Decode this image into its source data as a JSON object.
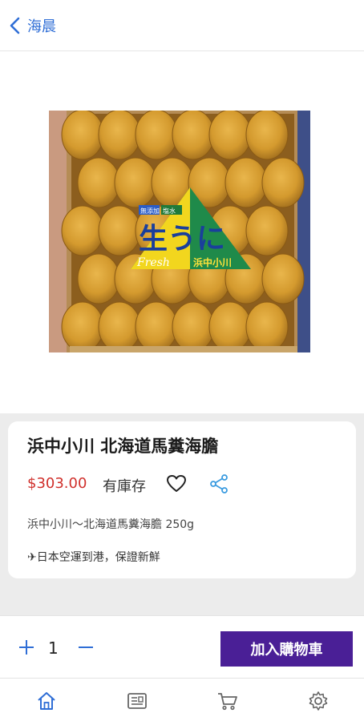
{
  "header": {
    "back_label": "海晨"
  },
  "product": {
    "name": "浜中小川 北海道馬糞海膽",
    "price": "$303.00",
    "stock_status": "有庫存",
    "description": "浜中小川～北海道馬糞海膽 250g",
    "note": "✈日本空運到港，保證新鮮",
    "image": {
      "label_main": "生うに",
      "label_fresh": "Fresh",
      "label_brand": "浜中小川",
      "label_tag1": "無添加",
      "label_tag2": "塩水"
    }
  },
  "cart": {
    "quantity": "1",
    "add_label": "加入購物車"
  },
  "colors": {
    "accent": "#2f6ed6",
    "price": "#d0302c",
    "button": "#4a1f96"
  },
  "tabs": [
    {
      "icon": "home-icon",
      "active": true
    },
    {
      "icon": "menu-icon",
      "active": false
    },
    {
      "icon": "cart-icon",
      "active": false
    },
    {
      "icon": "settings-icon",
      "active": false
    }
  ]
}
